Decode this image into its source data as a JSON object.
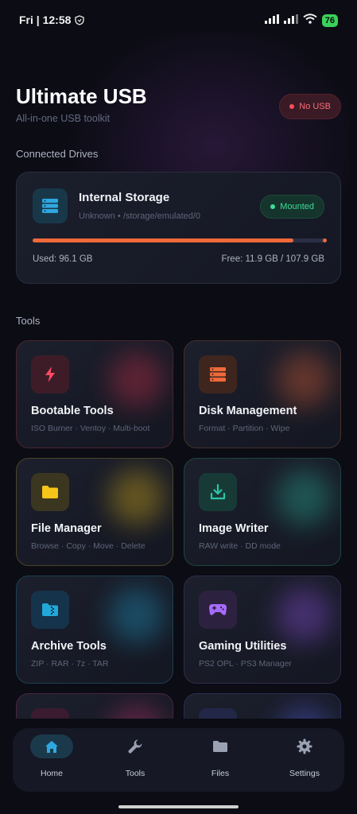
{
  "status_bar": {
    "time": "Fri | 12:58",
    "battery": "76"
  },
  "header": {
    "title": "Ultimate USB",
    "subtitle": "All-in-one USB toolkit",
    "badge": "No USB"
  },
  "sections": {
    "drives": "Connected Drives",
    "tools": "Tools"
  },
  "drive": {
    "name": "Internal Storage",
    "path": "Unknown • /storage/emulated/0",
    "status": "Mounted",
    "used_label": "Used: 96.1 GB",
    "free_label": "Free: 11.9 GB / 107.9 GB",
    "used_fraction": 0.89
  },
  "tools": [
    {
      "name": "Bootable Tools",
      "desc": "ISO Burner · Ventoy · Multi-boot",
      "icon": "bolt-icon",
      "color": "#e0344f"
    },
    {
      "name": "Disk Management",
      "desc": "Format · Partition · Wipe",
      "icon": "storage-icon",
      "color": "#f0693a"
    },
    {
      "name": "File Manager",
      "desc": "Browse · Copy · Move · Delete",
      "icon": "folder-icon",
      "color": "#f5c518"
    },
    {
      "name": "Image Writer",
      "desc": "RAW write · DD mode",
      "icon": "download-icon",
      "color": "#2ec4a8"
    },
    {
      "name": "Archive Tools",
      "desc": "ZIP · RAR · 7z · TAR",
      "icon": "archive-icon",
      "color": "#22a8d8"
    },
    {
      "name": "Gaming Utilities",
      "desc": "PS2 OPL · PS3 Manager",
      "icon": "gamepad-icon",
      "color": "#9b59f5"
    }
  ],
  "nav": {
    "items": [
      {
        "label": "Home",
        "icon": "home-icon",
        "active": true
      },
      {
        "label": "Tools",
        "icon": "wrench-icon",
        "active": false
      },
      {
        "label": "Files",
        "icon": "folder-icon",
        "active": false
      },
      {
        "label": "Settings",
        "icon": "gear-icon",
        "active": false
      }
    ]
  },
  "colors": {
    "accent": "#f0693a",
    "mounted": "#3ddc97",
    "alert": "#ff6b7a",
    "home": "#2fa8e0"
  }
}
